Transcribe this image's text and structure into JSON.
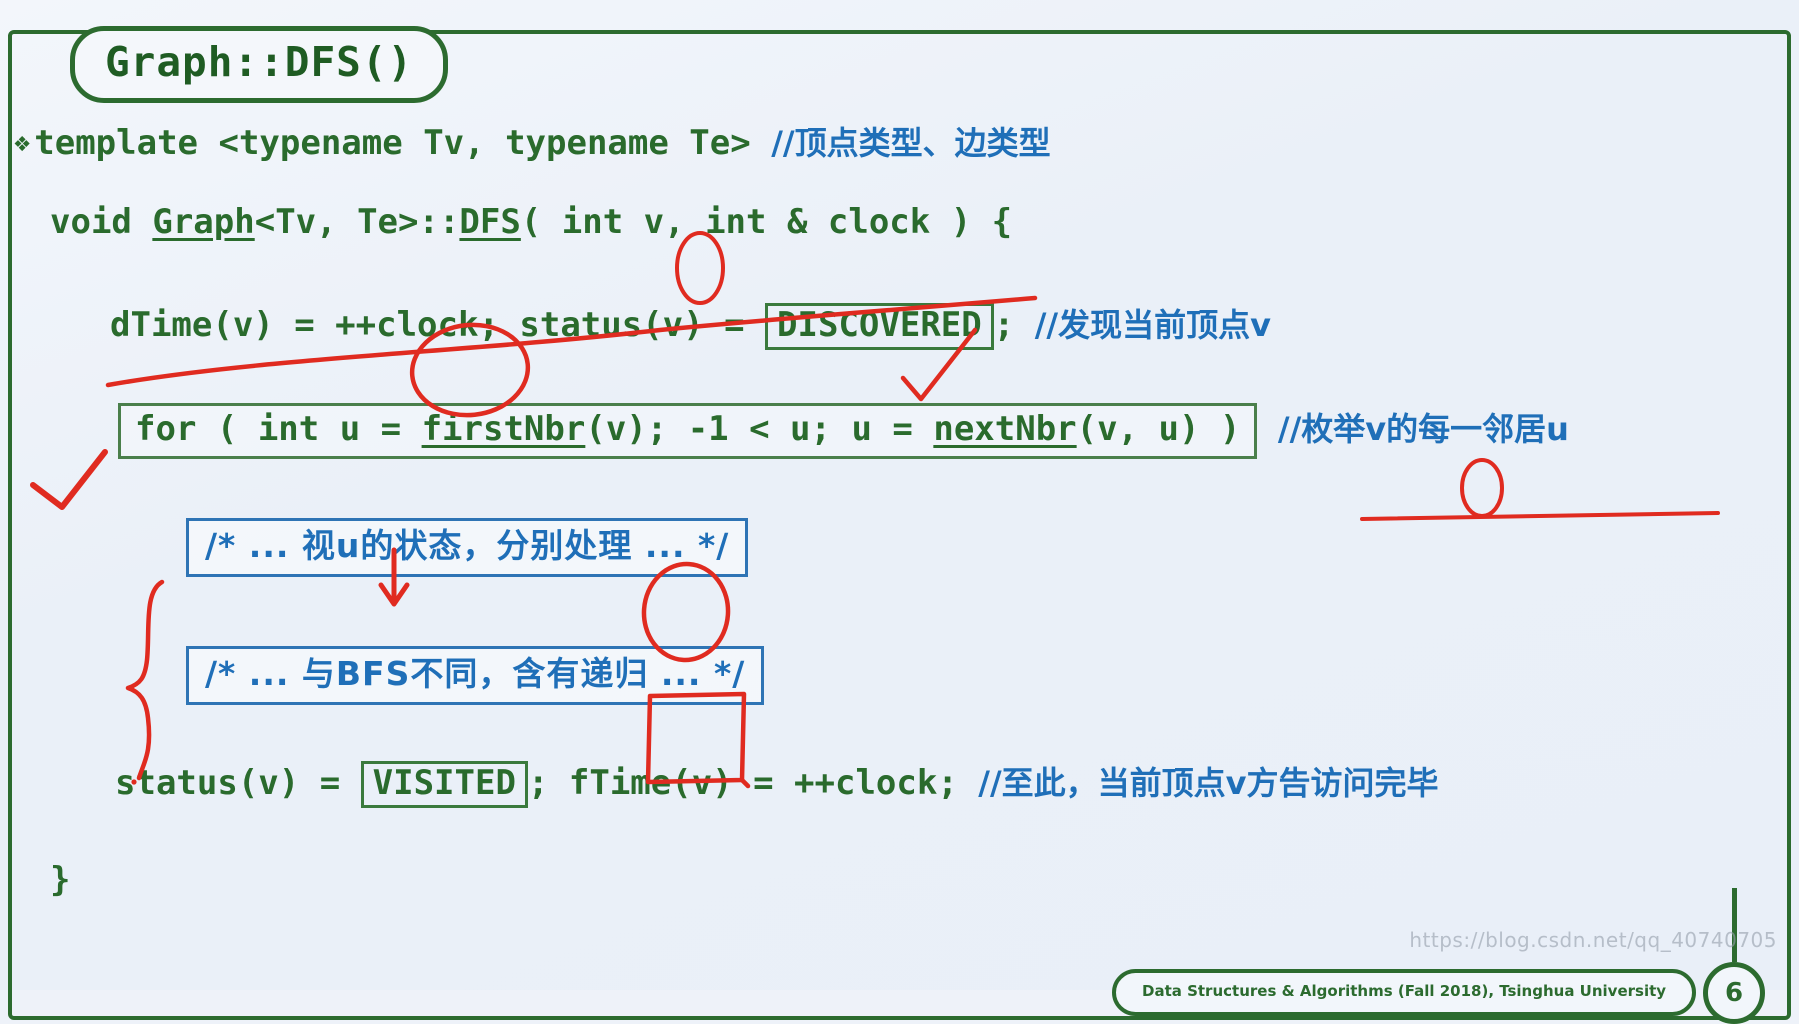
{
  "slide": {
    "title": "Graph::DFS()",
    "watermark": "https://blog.csdn.net/qq_40740705",
    "footer": "Data Structures & Algorithms (Fall 2018), Tsinghua University",
    "page_number": "6",
    "colors": {
      "frame_green": "#2c6b2f",
      "code_green": "#2a6b2d",
      "comment_blue": "#1f6fb8",
      "box_blue": "#2e74b5",
      "annotation_red": "#e02b20",
      "background": "#eef2f9"
    }
  },
  "code": {
    "line_template": {
      "bullet": "❖",
      "keyword": "template <typename Tv, typename Te>",
      "comment": "//顶点类型、边类型"
    },
    "line_signature": {
      "pre": "void ",
      "graph": "Graph",
      "mid": "<Tv, Te>::",
      "dfs": "DFS",
      "post": "( int v, int & clock ) {"
    },
    "line_dtime": {
      "pre": "dTime(v) = ++clock; status(v) = ",
      "boxed": "DISCOVERED",
      "post": ";",
      "comment": "//发现当前顶点v"
    },
    "line_for": {
      "pre": "for ( int u = ",
      "first_nbr": "firstNbr",
      "mid": "(v); -1 < u; u = ",
      "next_nbr": "nextNbr",
      "post": "(v, u) )",
      "comment": "//枚举v的每一邻居u"
    },
    "line_comment_box_1": "/* ... 视u的状态，分别处理 ... */",
    "line_comment_box_2": "/* ... 与BFS不同，含有递归 ... */",
    "line_status": {
      "pre": "status(v) = ",
      "boxed": "VISITED",
      "post": "; fTime(v) = ++clock;",
      "comment": "//至此，当前顶点v方告访问完毕"
    },
    "line_close": "}"
  },
  "annotations": {
    "circle_v_param": "red-ellipse-around-v-parameter",
    "underline_signature": "red-underline-under-DFS-signature",
    "circle_clock": "red-ellipse-around-++clock-semicolon",
    "check_discovered": "red-check-over-DISCOVERED",
    "check_for_loop": "red-check-left-of-for-loop",
    "circle_v_in_comment": "red-ellipse-around-v-in-enumerate-comment",
    "underline_comment": "red-underline-under-enumerate-comment",
    "arrow_down": "red-down-arrow-above-first-comment-box",
    "brace": "red-curly-brace-spanning-comment-boxes",
    "circle_handle": "red-ellipse-around-处理",
    "rect_recursion": "red-rectangle-around-递归"
  }
}
